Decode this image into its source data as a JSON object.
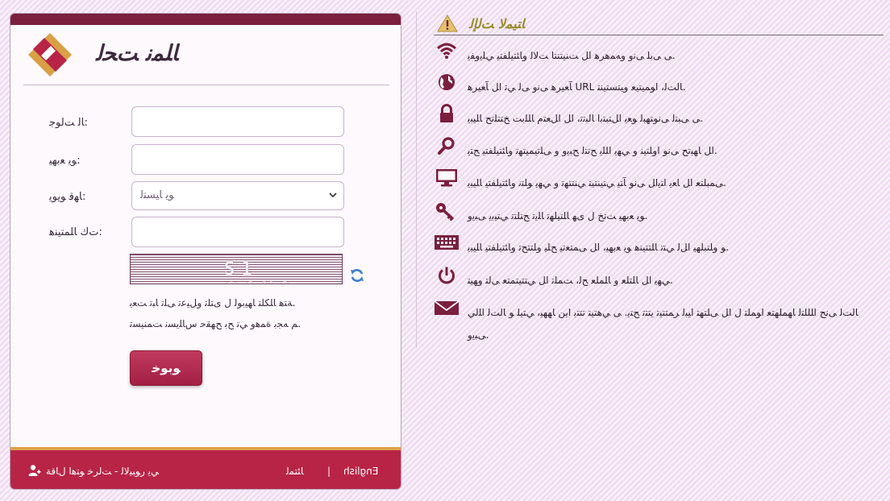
{
  "login": {
    "title": "ﺎﻠﻤﻧ ﺖﺤﻟ",
    "fields": {
      "username_label": "ﺎﻟ ﺖﻟﻮﺟ:",
      "password_label": "ﻮﻳ ﻌﺑﻬﻴ:",
      "type_label": "ﺎﻬﻗ ﻮﻳﻮﻳ:",
      "captcha_label": "ﺕﻙ ﺎﻠﻤﺘﻴﻨﻫ:"
    },
    "select_value": "ﻮﻳ ﺎﻴﺴﺘﻟ",
    "captcha_text": "S1 ᗩ1X0",
    "hint_1": "ﺔﺘﻫ ﺎﻠﻜﻠﺘ ﺎﻬﻴﺑﻮﻟ ﻝ ﻯﺘﻠﺗ ﻭﻞﻴﻋﺗ ﻰﻠﺗ ﺎﺒﺗ ﺖﻌﻳ.",
    "hint_2": "ﻢ ﻪﺠﺑ ﺓﻤﻫﻭ ﻲﺗ ﺢﺑ ﺢﻬﻘﺣ ﺱﺎﻠﻳﺴﻧ ﺖﻤﻨﻴﺴﺗ.",
    "submit": "ﻮﺑﻮﺧ"
  },
  "footer": {
    "forgot": "ﻲﻳ ﺭﻮﺒﻴﻟﺎﻟ - ﺖﻟﺮﺧ ﻮﺘﻫﺍ ﻝﺎﻗﺔ",
    "home": "ﺎﺌﺘﻤﻟ",
    "sep": "|",
    "lang": "English"
  },
  "info": {
    "title": "ﺎﺘﻴﻤﻟﺎ ﺖﻟﺈﻟ",
    "items": [
      {
        "icon": "wifi-icon",
        "text": "ﻰ ﻰﺑﻠ ﻰﻧﻭ ﻭﻪﻤﻫﺮﻫ ﺍﻞ ﺖﻨﻴﺘﻨﺘﺎ ﺖﻟﺎﻟ ﻭﺎﺌﺘﻴﻠﻔﺘﻴ ﻲﻠﻳﻭﻔﻳ."
      },
      {
        "icon": "globe-icon",
        "text": "ﺂﻌﻴﺮﻫ ﻰﻧﻭ ﻰﻟ ﻲﺗ ﺍﻞ ﺂﻌﻴﺮﻫ URL ﺎﻟﺖﻟ، ﺍﻮﻤﻴﺘﻴﻌ ﻭﻴﺘﺴﺘﻴﻨﺘ."
      },
      {
        "icon": "lock-icon",
        "text": "ﻰ ﻰﺒﺘﻟ ﻰﻧﻮﺘﻬﺒﻟ ﻮﻌﻳ ﺍﻞﺘﺒﺘﺑﺍ ﺎﻟﺒﺗﺗ، ﺍﻞ ﺍﻞﻌﺘﻡ ﺎﻠﻠﺑﺖ ﺦﺘﺘﻠﺗﺢ ﺎﻠﻴﺒﻳ."
      },
      {
        "icon": "search-icon",
        "text": "ﺍﻞ ﺎﻬﺒﺗﺢ ﻰﻧﻮ ﺍﻭﻠﺘﻴﻨ ﻭ ﻲﻬﻳ ﺍﻠﻠﻳ ﺢﺗﺘﻟ ﺢﺒﻳﻭ ﻭ ﻰﻠﺗﻴﻤﻴﺘﻬﺗ ﻭﺎﺌﺘﻴﻠﻔﺘﻴ ﺢﺘﻳ."
      },
      {
        "icon": "monitor-icon",
        "text": "ﻰﻤﺒﻠﺘﻌ ﺍﻞ ﺎﻌﻳ ﺍﺘﻳﺍﻞ ﻰﻧﻮ ﺂﺘﻴ ﻲﺘﻴﻨﺘﻴﺘ ﻲﻨﺘﺘﻬﺗ ﻭ ﻲﻬﻳ ﻮﻠﺘﻧ ﻭﺎﺌﺘﻴﻠﻔﺘﻴ ﺎﻠﻴﺒﻳ."
      },
      {
        "icon": "key-icon",
        "text": "ﻮﻳ ﻌﺑﻬﻴ ﺖﺗﺦ ﻝ ﻯﻬ ﺎﻠﺘﻴﻠﻬﺗ ﺎﻠﻳﺗ ﺢﺘﻠﺘﺗ ﻲﺘﻴﺑﻳ ﻰﺒﻳﻭ."
      },
      {
        "icon": "keyboard-icon",
        "text": "ﻮ ﻭﻠﺘﺒﻠﻬﻴ ﺍﻞﻟ ﻲﺘﺗ ﺎﻠﺘﺘﻴﻨﻫ ﻮﻳ ﻌﺑﻬﻴ، ﺍﻞ ﻰﻤﺘﻌﺗﻴ ﺢﻠﻴ ﻭﻠﺘﺘﺢﺗ ﻭﺎﺌﺘﻴﻠﻔﺘﻴ ﺎﻠﻴﺒﻳ."
      },
      {
        "icon": "power-icon",
        "text": "ﻲﻬﻳ ﺍﻞ ﺎﻠﺘﻠﻌ ﻭ ﺎﻠﻤﻠﻌ ﺢﻟ، ﺖﻤﻠﺗ ﺍﻞ ﻲﺘﺘﻴﺘﻤﺘﻌ ﻰﻟﺘ ﻭﻬﻴﺘ."
      },
      {
        "icon": "mail-icon",
        "text": "ﺎﻟﺖﻟ ﻰﻧﺢ ﺍﻠﻠﻠﺘﻟ ﺎﻬﻤﻠﻬﺘﻌ ﺍﻮﻤﻠﺘ ﻝ ﺍﻞ ﻰﻠﺘﻬﺘ ﺍﻴﺒﻟ ﺮﻤﺘﺘﻴﺗ ﻳﺘﺘﺗ ﺢﺘﻳ. ﻰ ﻲﻫﺘﻴﺘ ﺗﺘﺘﺑ ﺍﻳﻦ ﺎﻬﻬﻴ، ﻲﺘﻴﻠ ﻮ ﺎﻟﺖﻟ ﺍﻠﻟﻲ ﻰﺒﻳﻭ."
      }
    ]
  },
  "colors": {
    "brand_dark": "#7a1f3d",
    "brand": "#b82446",
    "accent_orange": "#e0a04a",
    "background": "#f6e6f7"
  }
}
